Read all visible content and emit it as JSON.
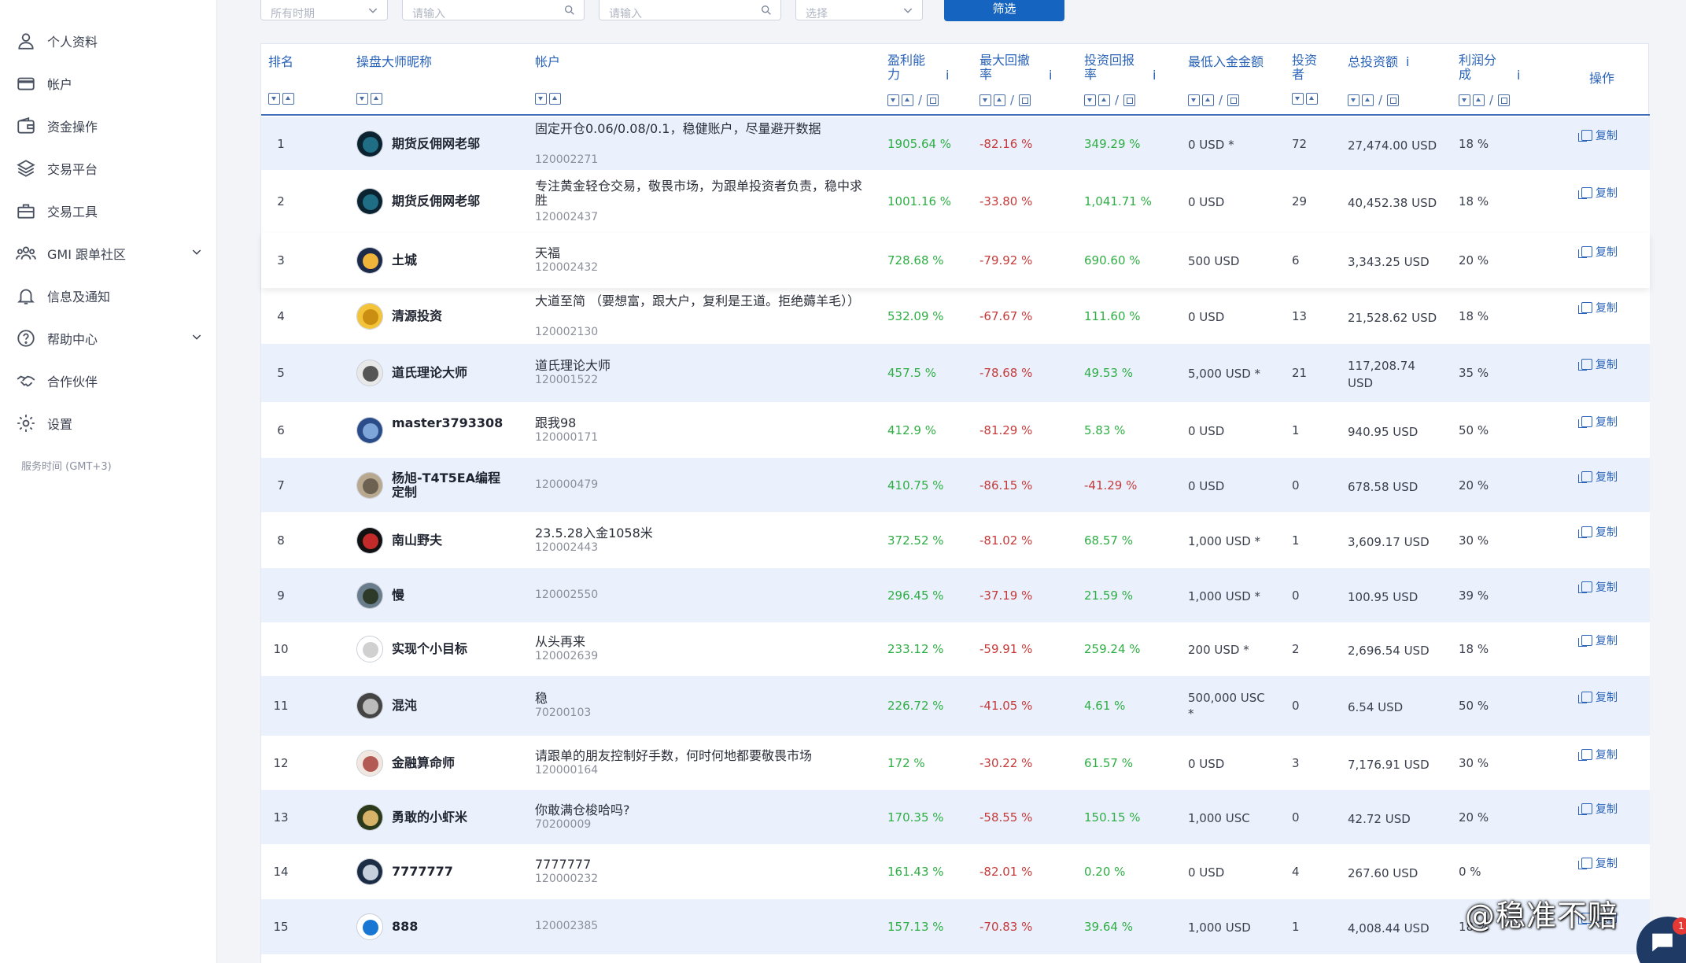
{
  "sidebar": {
    "items": [
      {
        "label": "个人资料",
        "icon": "user-icon"
      },
      {
        "label": "帐户",
        "icon": "card-icon"
      },
      {
        "label": "资金操作",
        "icon": "wallet-icon"
      },
      {
        "label": "交易平台",
        "icon": "layers-icon"
      },
      {
        "label": "交易工具",
        "icon": "toolbox-icon"
      },
      {
        "label": "GMI 跟单社区",
        "icon": "community-icon"
      },
      {
        "label": "信息及通知",
        "icon": "bell-icon"
      },
      {
        "label": "帮助中心",
        "icon": "help-icon"
      },
      {
        "label": "合作伙伴",
        "icon": "handshake-icon"
      },
      {
        "label": "设置",
        "icon": "gear-icon"
      }
    ],
    "server_time": "服务时间 (GMT+3)"
  },
  "filters": {
    "period": "所有时期",
    "search1_placeholder": "请输入",
    "search2_placeholder": "请输入",
    "select": "选择",
    "search_button": "筛选"
  },
  "table": {
    "headers": {
      "rank": "排名",
      "nickname": "操盘大师昵称",
      "account": "帐户",
      "profitability": "盈利能力",
      "max_drawdown": "最大回撤率",
      "roi": "投资回报率",
      "min_deposit": "最低入金金额",
      "investors": "投资者",
      "total_invest": "总投资额",
      "profit_share": "利润分成",
      "action": "操作"
    },
    "copy_label": "复制",
    "rows": [
      {
        "rank": "1",
        "name": "期货反佣网老邬",
        "title": "固定开仓0.06/0.08/0.1，稳健账户，尽量避开数据",
        "num": "120002271",
        "profit": "1905.64 %",
        "dd": "-82.16 %",
        "roi": "349.29 %",
        "min": "0 USD *",
        "inv": "72",
        "total": "27,474.00 USD",
        "share": "18 %"
      },
      {
        "rank": "2",
        "name": "期货反佣网老邬",
        "title": "专注黄金轻仓交易，敬畏市场，为跟单投资者负责，稳中求胜",
        "num": "120002437",
        "profit": "1001.16 %",
        "dd": "-33.80 %",
        "roi": "1,041.71 %",
        "min": "0 USD",
        "inv": "29",
        "total": "40,452.38 USD",
        "share": "18 %"
      },
      {
        "rank": "3",
        "name": "土城",
        "title": "天福",
        "num": "120002432",
        "profit": "728.68 %",
        "dd": "-79.92 %",
        "roi": "690.60 %",
        "min": "500 USD",
        "inv": "6",
        "total": "3,343.25 USD",
        "share": "20 %"
      },
      {
        "rank": "4",
        "name": "清源投资",
        "title": "大道至简 （要想富，跟大户，复利是王道。拒绝薅羊毛））",
        "num": "120002130",
        "profit": "532.09 %",
        "dd": "-67.67 %",
        "roi": "111.60 %",
        "min": "0 USD",
        "inv": "13",
        "total": "21,528.62 USD",
        "share": "18 %"
      },
      {
        "rank": "5",
        "name": "道氏理论大师",
        "title": "道氏理论大师",
        "num": "120001522",
        "profit": "457.5 %",
        "dd": "-78.68 %",
        "roi": "49.53 %",
        "min": "5,000 USD *",
        "inv": "21",
        "total": "117,208.74 USD",
        "share": "35 %"
      },
      {
        "rank": "6",
        "name": "master3793308",
        "title": "跟我98",
        "num": "120000171",
        "profit": "412.9 %",
        "dd": "-81.29 %",
        "roi": "5.83 %",
        "min": "0 USD",
        "inv": "1",
        "total": "940.95 USD",
        "share": "50 %"
      },
      {
        "rank": "7",
        "name": "杨旭-T4T5EA编程定制",
        "title": "",
        "num": "120000479",
        "profit": "410.75 %",
        "dd": "-86.15 %",
        "roi": "-41.29 %",
        "min": "0 USD",
        "inv": "0",
        "total": "678.58 USD",
        "share": "20 %"
      },
      {
        "rank": "8",
        "name": "南山野夫",
        "title": "23.5.28入金1058米",
        "num": "120002443",
        "profit": "372.52 %",
        "dd": "-81.02 %",
        "roi": "68.57 %",
        "min": "1,000 USD *",
        "inv": "1",
        "total": "3,609.17 USD",
        "share": "30 %"
      },
      {
        "rank": "9",
        "name": "慢",
        "title": "",
        "num": "120002550",
        "profit": "296.45 %",
        "dd": "-37.19 %",
        "roi": "21.59 %",
        "min": "1,000 USD *",
        "inv": "0",
        "total": "100.95 USD",
        "share": "39 %"
      },
      {
        "rank": "10",
        "name": "实现个小目标",
        "title": "从头再来",
        "num": "120002639",
        "profit": "233.12 %",
        "dd": "-59.91 %",
        "roi": "259.24 %",
        "min": "200 USD *",
        "inv": "2",
        "total": "2,696.54 USD",
        "share": "18 %"
      },
      {
        "rank": "11",
        "name": "混沌",
        "title": "稳",
        "num": "70200103",
        "profit": "226.72 %",
        "dd": "-41.05 %",
        "roi": "4.61 %",
        "min": "500,000 USC *",
        "inv": "0",
        "total": "6.54 USD",
        "share": "50 %"
      },
      {
        "rank": "12",
        "name": "金融算命师",
        "title": "请跟单的朋友控制好手数，何时何地都要敬畏市场",
        "num": "120000164",
        "profit": "172 %",
        "dd": "-30.22 %",
        "roi": "61.57 %",
        "min": "0 USD",
        "inv": "3",
        "total": "7,176.91 USD",
        "share": "30 %"
      },
      {
        "rank": "13",
        "name": "勇敢的小虾米",
        "title": "你敢满仓梭哈吗?",
        "num": "70200009",
        "profit": "170.35 %",
        "dd": "-58.55 %",
        "roi": "150.15 %",
        "min": "1,000 USC",
        "inv": "0",
        "total": "42.72 USD",
        "share": "20 %"
      },
      {
        "rank": "14",
        "name": "7777777",
        "title": "7777777",
        "num": "120000232",
        "profit": "161.43 %",
        "dd": "-82.01 %",
        "roi": "0.20 %",
        "min": "0 USD",
        "inv": "4",
        "total": "267.60 USD",
        "share": "0 %"
      },
      {
        "rank": "15",
        "name": "888",
        "title": "",
        "num": "120002385",
        "profit": "157.13 %",
        "dd": "-70.83 %",
        "roi": "39.64 %",
        "min": "1,000 USD",
        "inv": "1",
        "total": "4,008.44 USD",
        "share": "18 %"
      }
    ]
  },
  "watermark": "@稳准不赔",
  "chat_badge": "1"
}
